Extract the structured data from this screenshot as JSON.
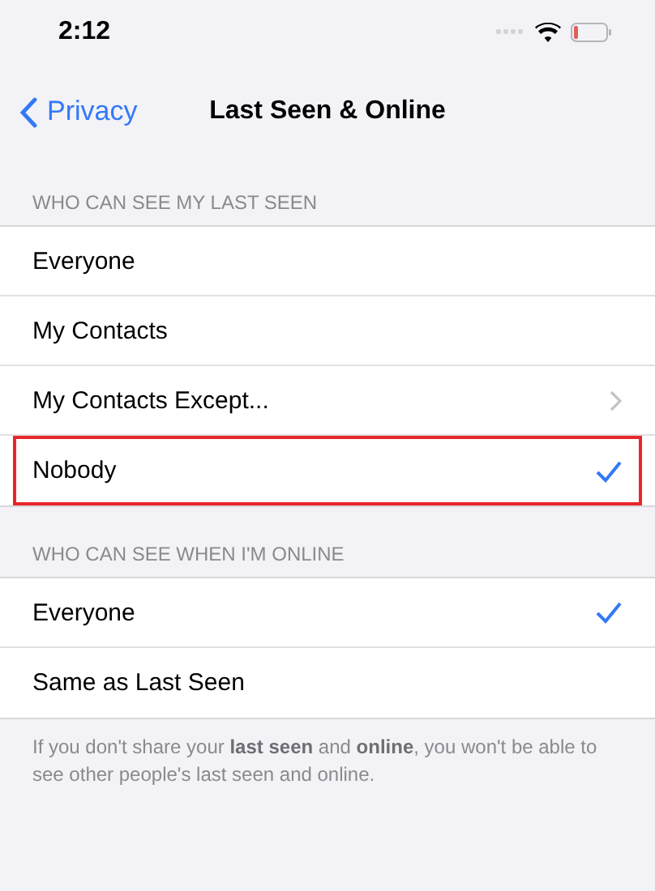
{
  "status_bar": {
    "time": "2:12"
  },
  "nav": {
    "back": "Privacy",
    "title": "Last Seen & Online"
  },
  "sections": [
    {
      "header": "WHO CAN SEE MY LAST SEEN",
      "items": [
        {
          "label": "Everyone",
          "kind": "option",
          "selected": false,
          "highlighted": false
        },
        {
          "label": "My Contacts",
          "kind": "option",
          "selected": false,
          "highlighted": false
        },
        {
          "label": "My Contacts Except...",
          "kind": "submenu",
          "selected": false,
          "highlighted": false
        },
        {
          "label": "Nobody",
          "kind": "option",
          "selected": true,
          "highlighted": true
        }
      ]
    },
    {
      "header": "WHO CAN SEE WHEN I'M ONLINE",
      "items": [
        {
          "label": "Everyone",
          "kind": "option",
          "selected": true,
          "highlighted": false
        },
        {
          "label": "Same as Last Seen",
          "kind": "option",
          "selected": false,
          "highlighted": false
        }
      ],
      "footer": "If you don't share your **last seen** and **online**, you won't be able to see other people's last seen and online."
    }
  ]
}
